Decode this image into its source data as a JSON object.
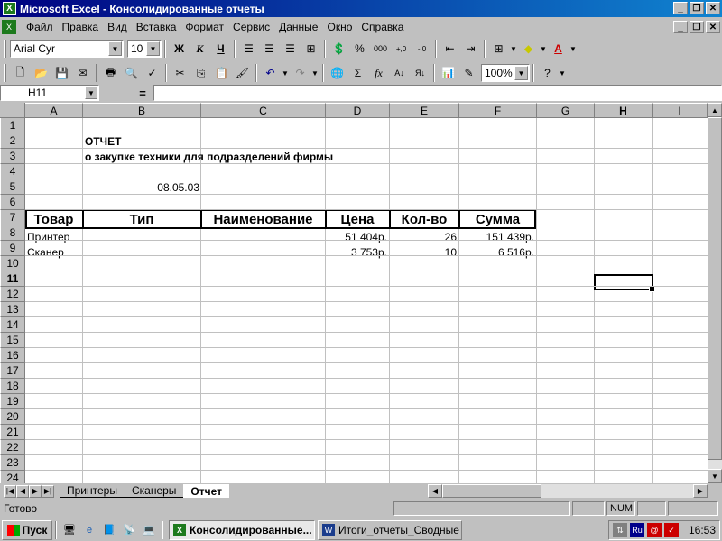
{
  "window": {
    "title": "Microsoft Excel - Консолидированные отчеты"
  },
  "menu": [
    "Файл",
    "Правка",
    "Вид",
    "Вставка",
    "Формат",
    "Сервис",
    "Данные",
    "Окно",
    "Справка"
  ],
  "format_toolbar": {
    "font_name": "Arial Cyr",
    "font_size": "10",
    "bold": "Ж",
    "italic": "К",
    "underline": "Ч",
    "percent": "%",
    "thousands": "000",
    "inc_decimal": ",0→,00",
    "dec_decimal": ",00→,0"
  },
  "standard_toolbar": {
    "zoom": "100%",
    "sum": "Σ",
    "function": "fx"
  },
  "formula_bar": {
    "cell_ref": "H11",
    "equals": "=",
    "value": ""
  },
  "columns": [
    "A",
    "B",
    "C",
    "D",
    "E",
    "F",
    "G",
    "H",
    "I"
  ],
  "rows": [
    "1",
    "2",
    "3",
    "4",
    "5",
    "6",
    "7",
    "8",
    "9",
    "10",
    "11",
    "12",
    "13",
    "14",
    "15",
    "16",
    "17",
    "18",
    "19",
    "20",
    "21",
    "22",
    "23",
    "24"
  ],
  "active_cell": {
    "column": "H",
    "row": "11"
  },
  "sheet": {
    "title": "ОТЧЕТ",
    "subtitle": "о закупке техники для подразделений фирмы",
    "date": "08.05.03",
    "headers": [
      "Товар",
      "Тип",
      "Наименование",
      "Цена",
      "Кол-во",
      "Сумма"
    ],
    "data_rows": [
      {
        "product": "Принтер",
        "type": "",
        "name": "",
        "price": "51 404р.",
        "qty": "26",
        "sum": "151 439р."
      },
      {
        "product": "Сканер",
        "type": "",
        "name": "",
        "price": "3 753р.",
        "qty": "10",
        "sum": "6 516р."
      }
    ]
  },
  "sheet_tabs": [
    "Принтеры",
    "Сканеры",
    "Отчет"
  ],
  "active_sheet": "Отчет",
  "status": {
    "text": "Готово",
    "num": "NUM"
  },
  "taskbar": {
    "start": "Пуск",
    "tasks": [
      "Консолидированные...",
      "Итоги_отчеты_Сводные ..."
    ],
    "lang": "Ru",
    "clock": "16:53"
  },
  "colors": {
    "title_start": "#000080",
    "title_end": "#1084d0",
    "face": "#c0c0c0"
  }
}
